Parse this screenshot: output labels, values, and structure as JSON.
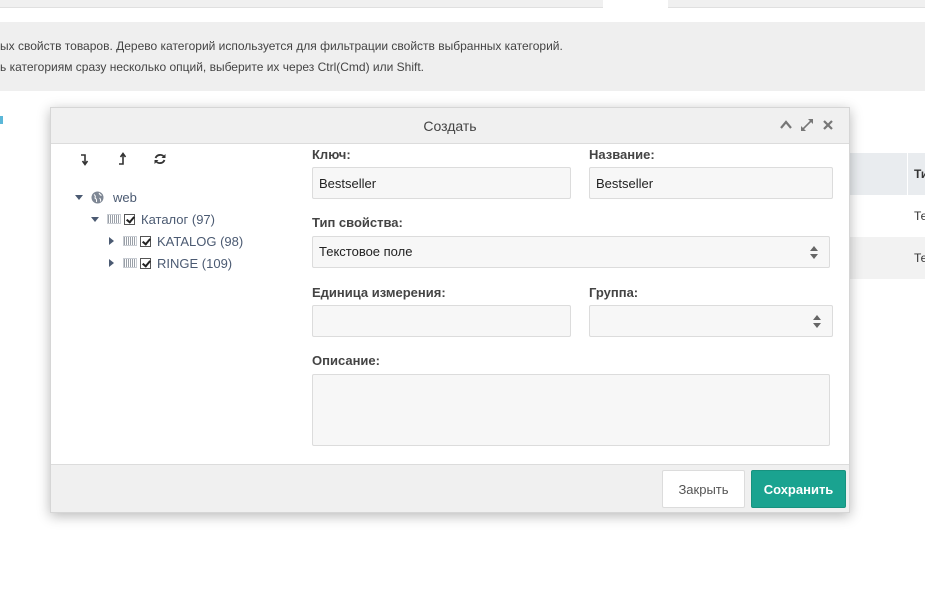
{
  "background": {
    "notice_line1": "ых свойств товаров. Дерево категорий используется для фильтрации свойств выбранных категорий.",
    "notice_line2": "ь категориям сразу несколько опций, выберите их через Ctrl(Cmd) или Shift.",
    "table": {
      "header_col": "Ти",
      "rows": [
        "Те",
        "Те"
      ]
    }
  },
  "modal": {
    "title": "Создать",
    "header_icons": [
      "chevron-up-icon",
      "expand-icon",
      "close-icon"
    ],
    "tree_toolbar": [
      "expand-all-icon",
      "collapse-all-icon",
      "refresh-icon"
    ],
    "tree": {
      "root": "web",
      "catalog": "Каталог (97)",
      "children": [
        "KATALOG (98)",
        "RINGE (109)"
      ]
    },
    "form": {
      "key_label": "Ключ:",
      "key_value": "Bestseller",
      "name_label": "Название:",
      "name_value": "Bestseller",
      "type_label": "Тип свойства:",
      "type_value": "Текстовое поле",
      "unit_label": "Единица измерения:",
      "unit_value": "",
      "group_label": "Группа:",
      "group_value": "",
      "description_label": "Описание:",
      "description_value": ""
    },
    "footer": {
      "close_label": "Закрыть",
      "save_label": "Сохранить"
    },
    "colors": {
      "save_button": "#1aa390",
      "tree_text": "#4b5a72"
    }
  }
}
